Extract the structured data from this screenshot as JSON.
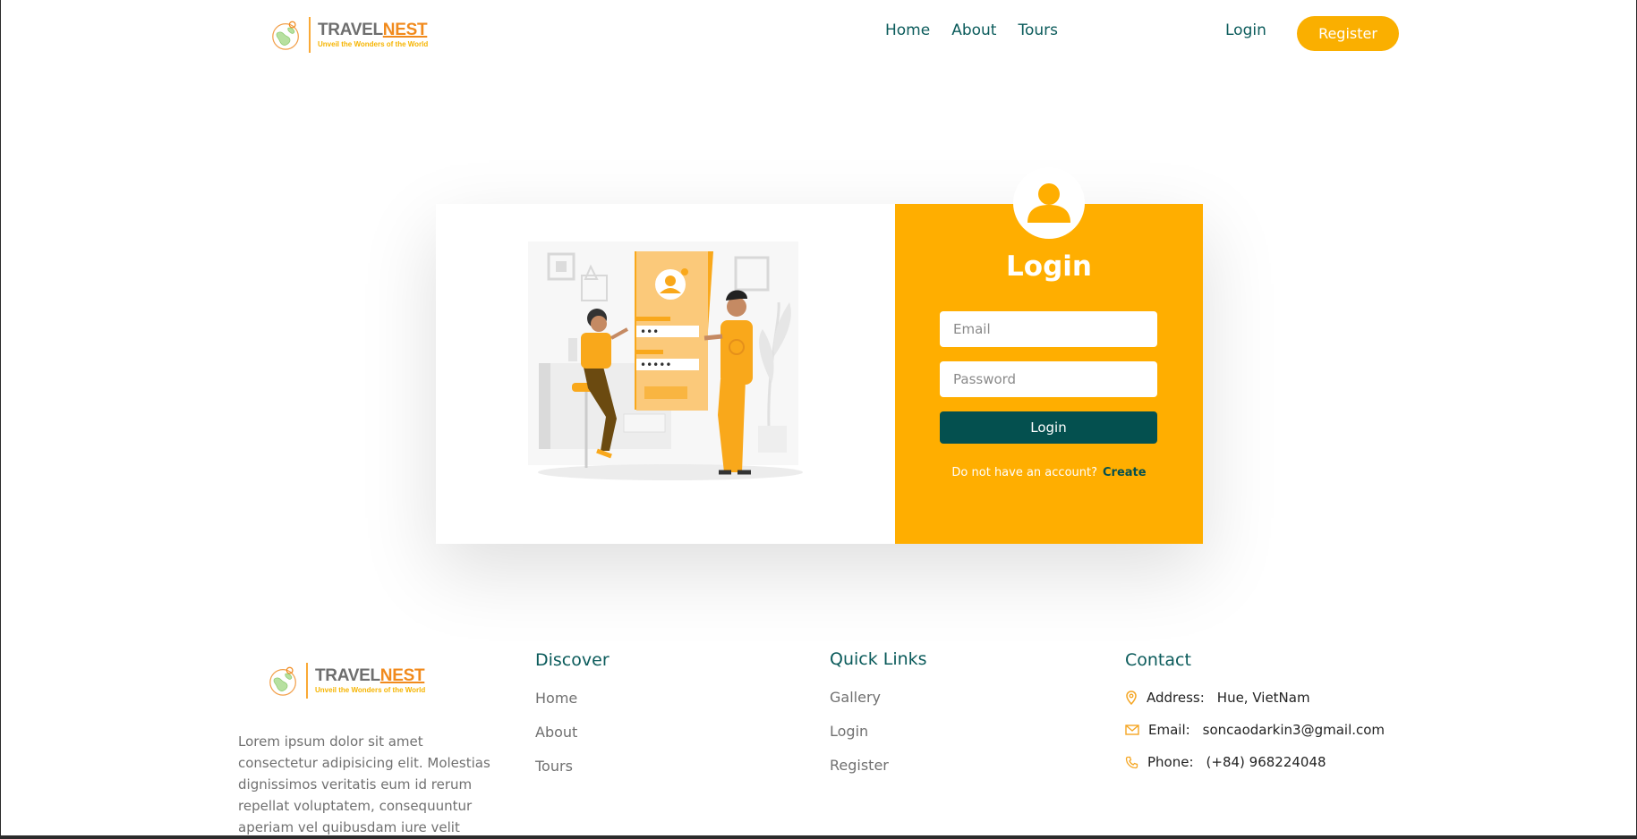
{
  "header": {
    "brand_travel": "TRAVEL",
    "brand_nest": "NEST",
    "tagline": "Unveil the Wonders of the World",
    "nav": [
      "Home",
      "About",
      "Tours"
    ],
    "login": "Login",
    "register": "Register"
  },
  "login_card": {
    "title": "Login",
    "email_placeholder": "Email",
    "password_placeholder": "Password",
    "login_button": "Login",
    "no_account": "Do not have an account?",
    "create": "Create"
  },
  "footer": {
    "description": "Lorem ipsum dolor sit amet consectetur adipisicing elit. Molestias dignissimos veritatis eum id rerum repellat voluptatem, consequuntur aperiam vel quibusdam iure velit voluptatum hic",
    "discover": {
      "title": "Discover",
      "links": [
        "Home",
        "About",
        "Tours"
      ]
    },
    "quick_links": {
      "title": "Quick Links",
      "links": [
        "Gallery",
        "Login",
        "Register"
      ]
    },
    "contact": {
      "title": "Contact",
      "address_label": "Address:",
      "address": "Hue, VietNam",
      "email_label": "Email:",
      "email": "soncaodarkin3@gmail.com",
      "phone_label": "Phone:",
      "phone": "(+84) 968224048"
    }
  },
  "colors": {
    "accent": "#faaf00",
    "primary": "#04504f",
    "nav": "#0b5b5b"
  }
}
